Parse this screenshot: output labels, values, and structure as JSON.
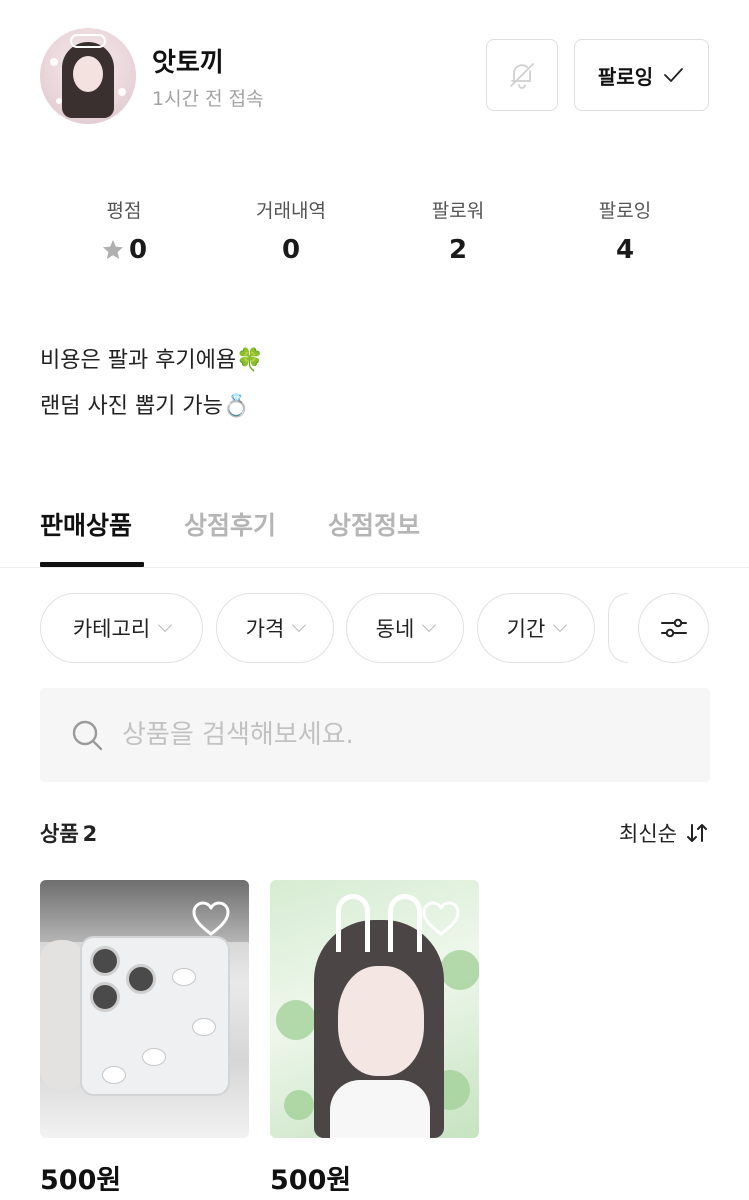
{
  "profile": {
    "shop_name": "앗토끼",
    "last_seen": "1시간 전 접속",
    "avatar": "avatar-photo",
    "bell_icon": "bell-off-icon",
    "follow_label": "팔로잉",
    "follow_icon": "check-icon"
  },
  "stats": [
    {
      "label": "평점",
      "value": "0",
      "icon": "star-icon"
    },
    {
      "label": "거래내역",
      "value": "0"
    },
    {
      "label": "팔로워",
      "value": "2"
    },
    {
      "label": "팔로잉",
      "value": "4"
    }
  ],
  "bio": {
    "line1": "비용은 팔과 후기에욤🍀",
    "line2": "랜덤 사진 뽑기 가능💍"
  },
  "tabs": [
    {
      "label": "판매상품",
      "active": true
    },
    {
      "label": "상점후기",
      "active": false
    },
    {
      "label": "상점정보",
      "active": false
    }
  ],
  "filters": {
    "chips": [
      "카테고리",
      "가격",
      "동네",
      "기간"
    ],
    "filter_icon": "sliders-icon"
  },
  "search": {
    "placeholder": "상품을 검색해보세요.",
    "value": "",
    "icon": "search-icon"
  },
  "products_header": {
    "label": "상품",
    "count": "2",
    "sort_label": "최신순",
    "sort_icon": "sort-arrows-icon"
  },
  "products": [
    {
      "price": "500원",
      "title": "",
      "liked": false
    },
    {
      "price": "500원",
      "title": "",
      "liked": false
    }
  ],
  "colors": {
    "text": "#1a1a1a",
    "muted": "#a3a3a3",
    "border": "#dedede",
    "search_bg": "#f6f6f6",
    "star": "#b0b0b0"
  }
}
